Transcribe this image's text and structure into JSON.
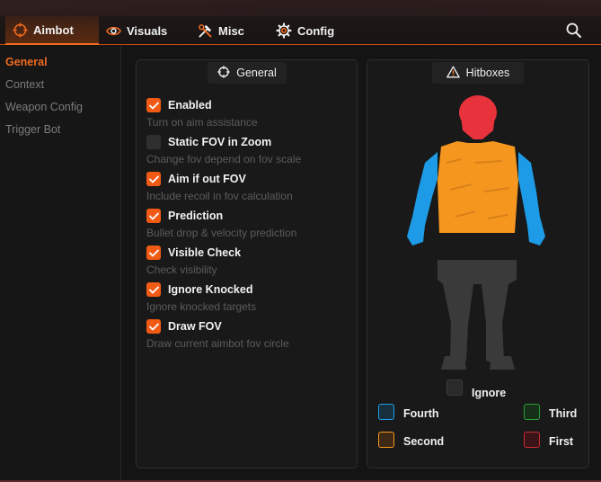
{
  "tabs": [
    {
      "label": "Aimbot",
      "icon": "crosshair-icon",
      "active": true
    },
    {
      "label": "Visuals",
      "icon": "eye-icon",
      "active": false
    },
    {
      "label": "Misc",
      "icon": "tools-icon",
      "active": false
    },
    {
      "label": "Config",
      "icon": "gear-icon",
      "active": false
    }
  ],
  "sidebar": {
    "items": [
      {
        "label": "General",
        "active": true
      },
      {
        "label": "Context",
        "active": false
      },
      {
        "label": "Weapon Config",
        "active": false
      },
      {
        "label": "Trigger Bot",
        "active": false
      }
    ]
  },
  "general_panel": {
    "title": "General",
    "options": [
      {
        "label": "Enabled",
        "description": "Turn on aim assistance",
        "checked": true
      },
      {
        "label": "Static FOV in Zoom",
        "description": "Change fov depend on fov scale",
        "checked": false
      },
      {
        "label": "Aim if out FOV",
        "description": "Include recoil in fov calculation",
        "checked": true
      },
      {
        "label": "Prediction",
        "description": "Bullet drop & velocity prediction",
        "checked": true
      },
      {
        "label": "Visible Check",
        "description": "Check visibility",
        "checked": true
      },
      {
        "label": "Ignore Knocked",
        "description": "Ignore knocked targets",
        "checked": true
      },
      {
        "label": "Draw FOV",
        "description": "Draw current aimbot fov circle",
        "checked": true
      }
    ]
  },
  "hitboxes_panel": {
    "title": "Hitboxes",
    "ignore_label": "Ignore",
    "legend": {
      "fourth": "Fourth",
      "third": "Third",
      "second": "Second",
      "first": "First"
    }
  },
  "colors": {
    "accent": "#f05a14",
    "head": "#e8323c",
    "torso": "#f5961e",
    "arms": "#1e9be6",
    "ignored": "#3a3a3a"
  }
}
